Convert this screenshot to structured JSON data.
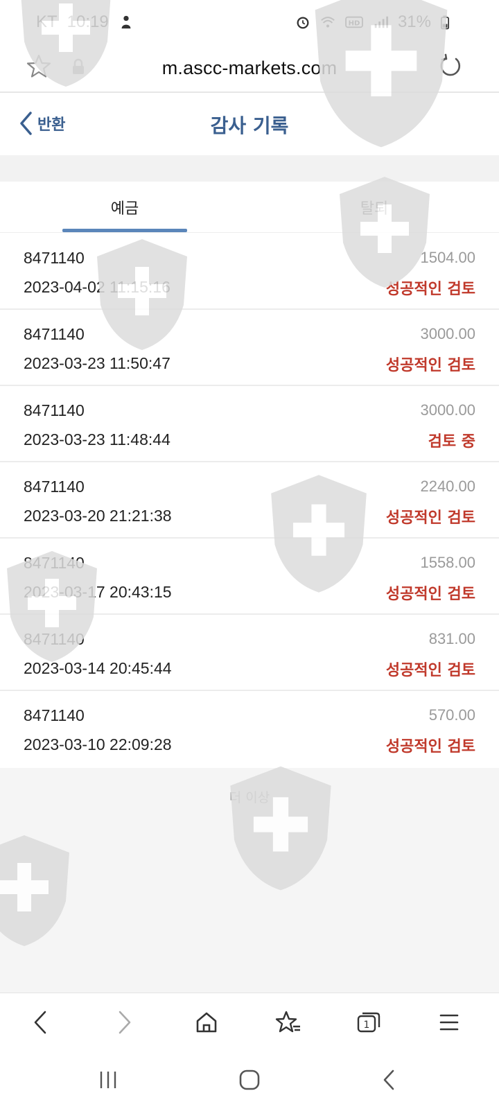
{
  "status_bar": {
    "carrier": "KT",
    "time": "10:19",
    "battery": "31%",
    "icons": [
      "person-icon",
      "alarm-icon",
      "wifi-icon",
      "hd-icon",
      "signal-icon",
      "battery-icon"
    ]
  },
  "url_bar": {
    "url": "m.ascc-markets.com",
    "icons": [
      "star-icon",
      "lock-icon",
      "reload-icon"
    ]
  },
  "header": {
    "back_label": "반환",
    "title": "감사 기록"
  },
  "tabs": [
    {
      "label": "예금",
      "active": true
    },
    {
      "label": "탈퇴",
      "active": false
    }
  ],
  "records": [
    {
      "id": "8471140",
      "datetime": "2023-04-02 11:15:16",
      "amount": "1504.00",
      "status": "성공적인 검토"
    },
    {
      "id": "8471140",
      "datetime": "2023-03-23 11:50:47",
      "amount": "3000.00",
      "status": "성공적인 검토"
    },
    {
      "id": "8471140",
      "datetime": "2023-03-23 11:48:44",
      "amount": "3000.00",
      "status": "검토 중"
    },
    {
      "id": "8471140",
      "datetime": "2023-03-20 21:21:38",
      "amount": "2240.00",
      "status": "성공적인 검토"
    },
    {
      "id": "8471140",
      "datetime": "2023-03-17 20:43:15",
      "amount": "1558.00",
      "status": "성공적인 검토"
    },
    {
      "id": "8471140",
      "datetime": "2023-03-14 20:45:44",
      "amount": "831.00",
      "status": "성공적인 검토"
    },
    {
      "id": "8471140",
      "datetime": "2023-03-10 22:09:28",
      "amount": "570.00",
      "status": "성공적인 검토"
    }
  ],
  "footer": {
    "no_more_text": "더 이상"
  },
  "browser_nav": [
    "back-icon",
    "forward-icon",
    "home-icon",
    "bookmarks-icon",
    "tabs-icon",
    "menu-icon"
  ],
  "tabs_count": "1",
  "system_nav": [
    "recents-icon",
    "home-button-icon",
    "back-gesture-icon"
  ],
  "colors": {
    "accent": "#3a5f8f",
    "tab_indicator": "#5b86ba",
    "status_red": "#c0392b",
    "amount_gray": "#9a9a9a",
    "watermark": "#d9d9d9"
  }
}
